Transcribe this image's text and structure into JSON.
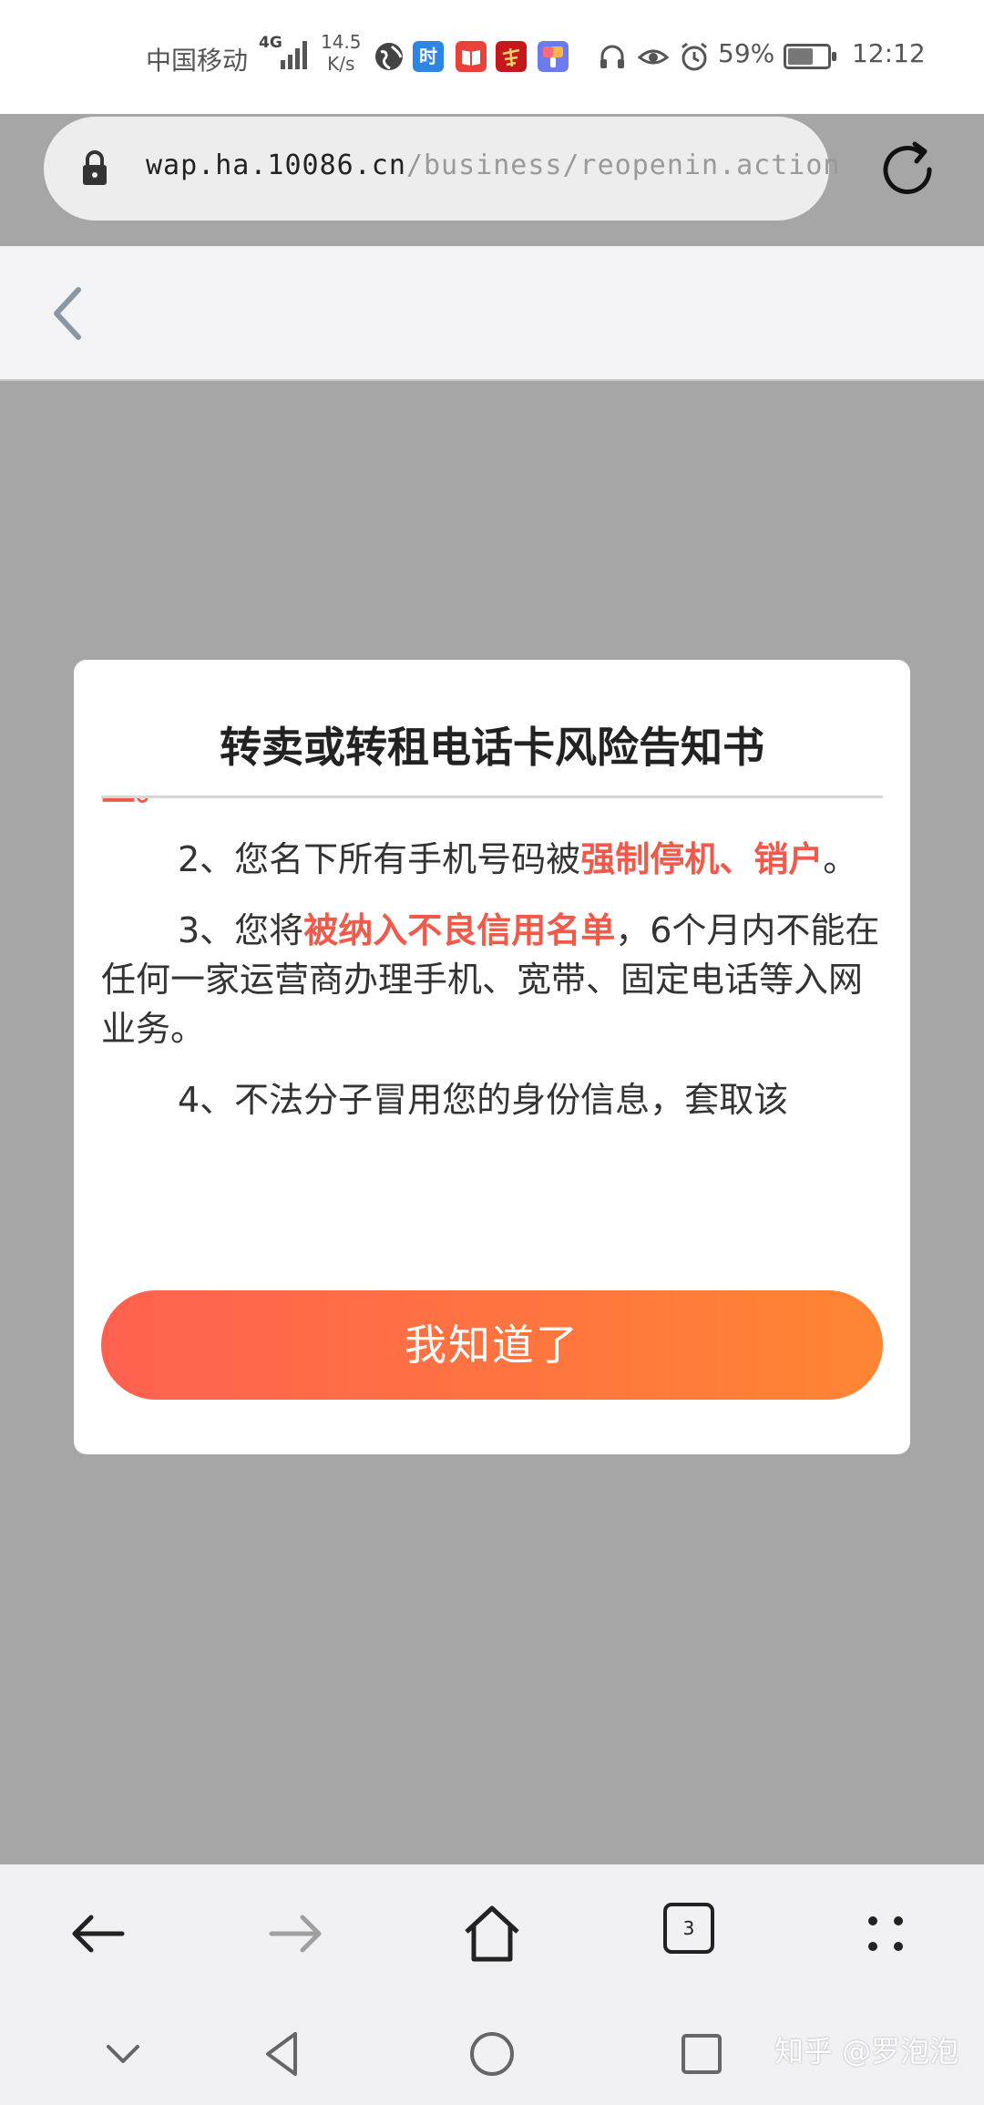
{
  "status_bar": {
    "carrier": "中国移动",
    "network": "4G",
    "speed_value": "14.5",
    "speed_unit": "K/s",
    "app_icon_time": "时",
    "battery": "59%",
    "time": "12:12",
    "battery_level": 0.59
  },
  "url_bar": {
    "domain": "wap.ha.10086.cn",
    "path": "/business/reopenin.action"
  },
  "modal": {
    "title": "转卖或转租电话卡风险告知书",
    "clipped_top_text": "业。",
    "para2_prefix": "2、您名下所有手机号码被",
    "para2_highlight": "强制停机、销户",
    "para2_suffix": "。",
    "para3_prefix": "3、您将",
    "para3_highlight": "被纳入不良信用名单",
    "para3_suffix": "，6个月内不能在任何一家运营商办理手机、宽带、固定电话等入网业务。",
    "para4": "4、不法分子冒用您的身份信息，套取该",
    "button_label": "我知道了"
  },
  "toolbar": {
    "tab_count": "3"
  },
  "watermark": "知乎 @罗泡泡",
  "colors": {
    "highlight_red": "#f05a4a",
    "button_start": "#ff6150",
    "button_end": "#ff8532",
    "overlay_gray": "#a6a6a6"
  }
}
